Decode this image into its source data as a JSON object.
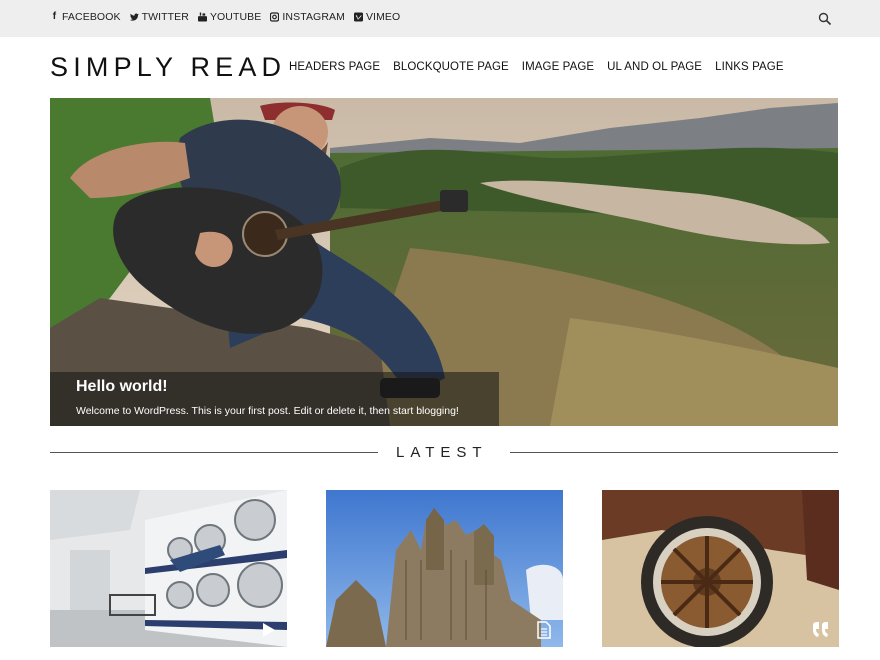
{
  "social": [
    {
      "icon": "facebook-icon",
      "glyph": "f",
      "label": "FACEBOOK"
    },
    {
      "icon": "twitter-icon",
      "glyph": "♦",
      "label": "TWITTER"
    },
    {
      "icon": "youtube-icon",
      "glyph": "▶",
      "label": "YOUTUBE"
    },
    {
      "icon": "instagram-icon",
      "glyph": "▣",
      "label": "INSTAGRAM"
    },
    {
      "icon": "vimeo-icon",
      "glyph": "v",
      "label": "VIMEO"
    }
  ],
  "site": {
    "title": "SIMPLY READ"
  },
  "nav": [
    "HEADERS PAGE",
    "BLOCKQUOTE PAGE",
    "IMAGE PAGE",
    "UL AND OL PAGE",
    "LINKS PAGE"
  ],
  "hero": {
    "title": "Hello world!",
    "excerpt": "Welcome to WordPress. This is your first post. Edit or delete it, then start blogging!"
  },
  "latest": {
    "title": "LATEST"
  },
  "cards": [
    {
      "image": "laundromat-photo",
      "format_icon": "video-play-icon"
    },
    {
      "image": "cathedral-photo",
      "format_icon": "document-icon"
    },
    {
      "image": "rusty-wheel-photo",
      "format_icon": "quote-icon"
    }
  ],
  "colors": {
    "topbar": "#eeeeee",
    "text": "#222222",
    "caption_bg": "rgba(20,20,20,0.55)"
  }
}
